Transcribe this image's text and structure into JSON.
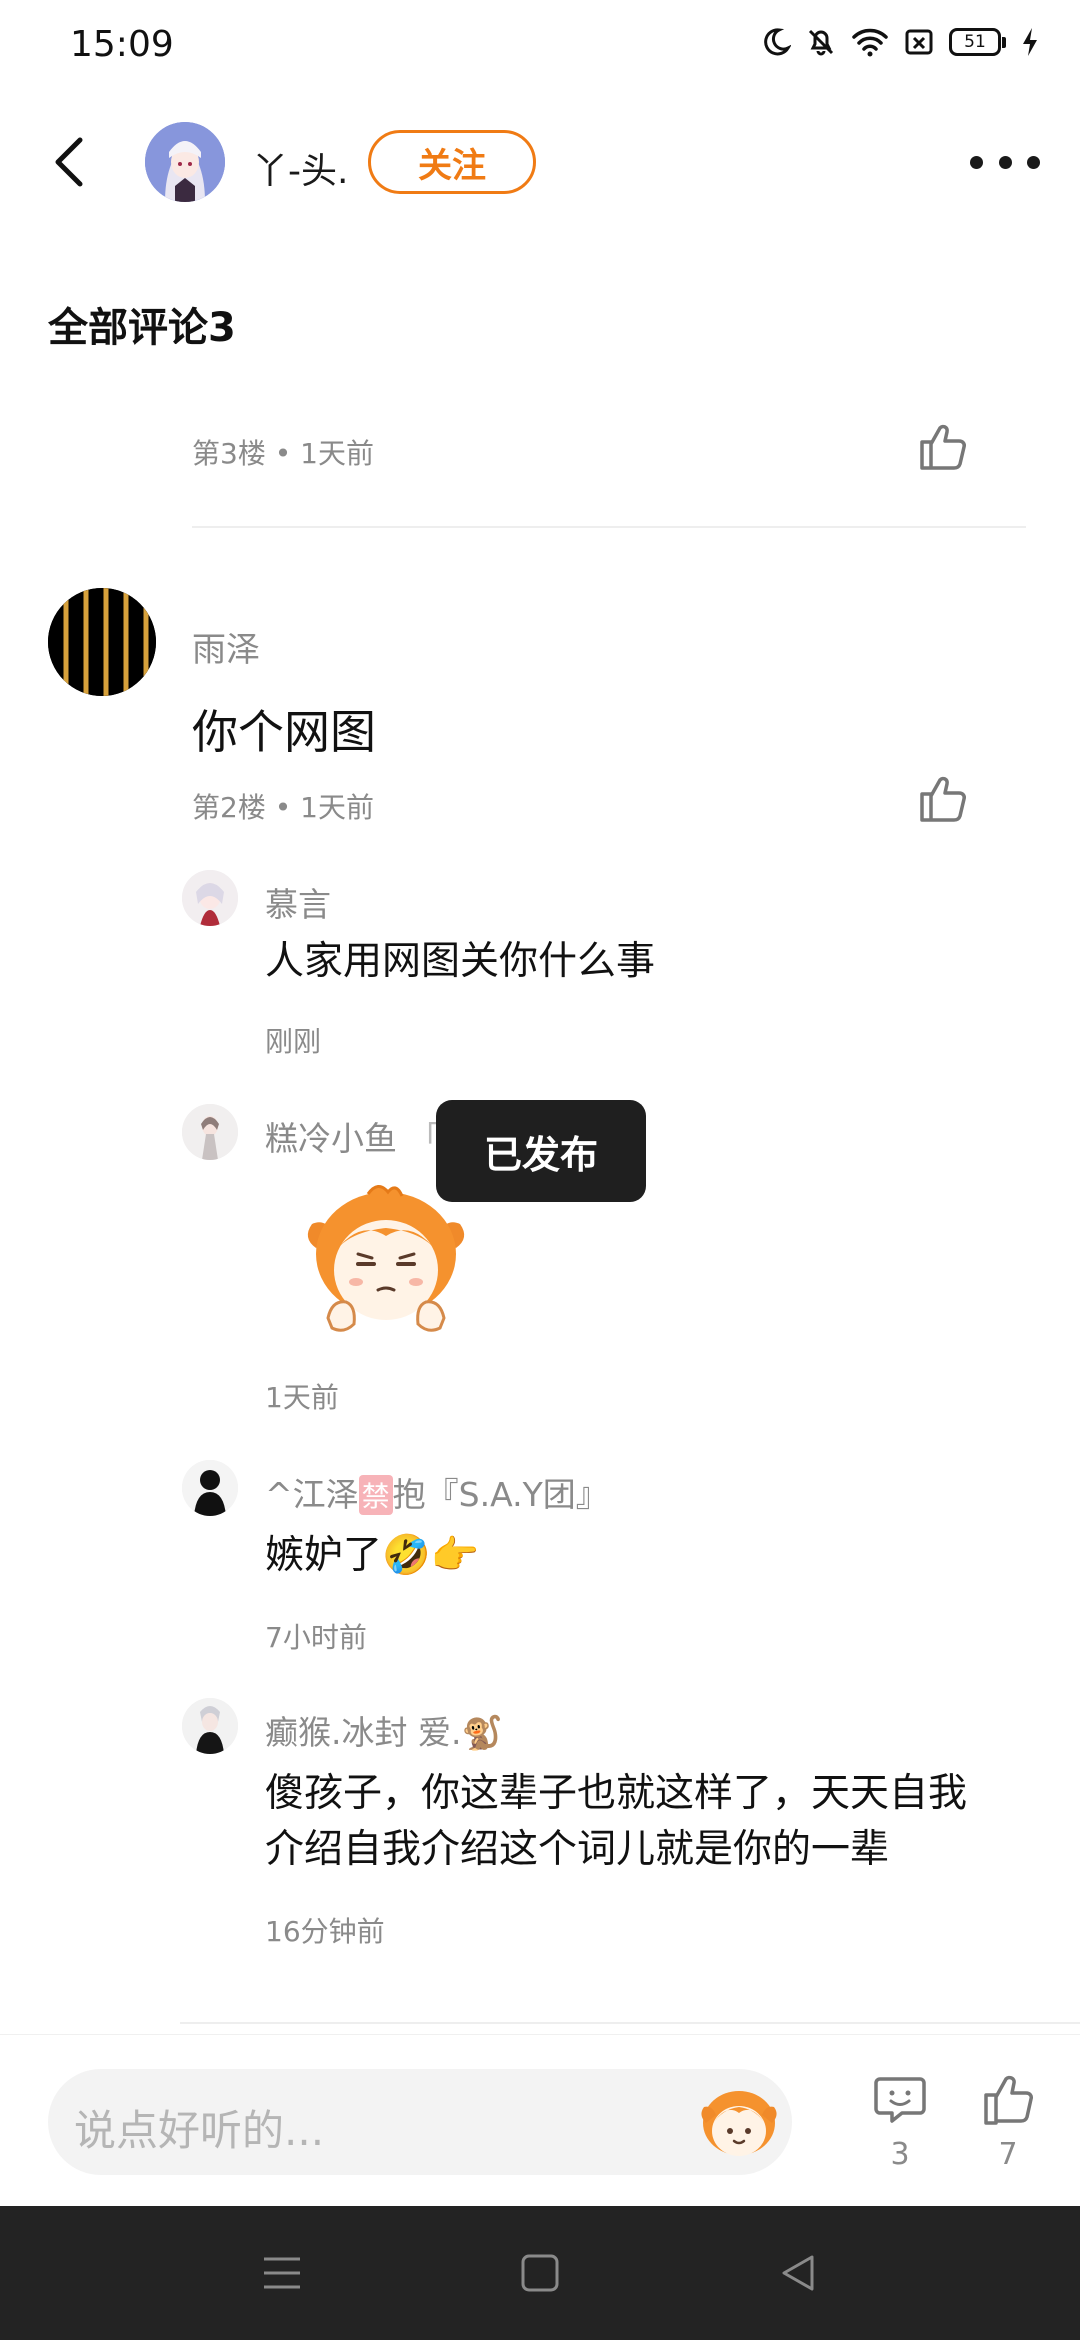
{
  "status_bar": {
    "time": "15:09",
    "battery": "51"
  },
  "header": {
    "username": "丫-头.",
    "follow_label": "关注"
  },
  "comments_title": "全部评论3",
  "floor3": {
    "meta": "第3楼 • 1天前"
  },
  "floor2": {
    "username": "雨泽",
    "content": "你个网图",
    "meta": "第2楼 • 1天前",
    "replies": [
      {
        "username": "慕言",
        "content": "人家用网图关你什么事",
        "time": "刚刚"
      },
      {
        "username": "糕冷小鱼",
        "name_suffix": "「",
        "time": "1天前"
      },
      {
        "username_prefix": "^江泽",
        "username_tag": "禁",
        "username_suffix": "抱『S.A.Y团』",
        "content": "嫉妒了🤣👉",
        "time": "7小时前"
      },
      {
        "username": "癫猴.冰封 爱.🐒",
        "content_line1": "傻孩子，你这辈子也就这样了，天天自我",
        "content_line2": "介绍自我介绍这个词儿就是你的一辈",
        "time": "16分钟前"
      }
    ]
  },
  "toast": "已发布",
  "input": {
    "placeholder": "说点好听的..."
  },
  "actions": {
    "comments_count": "3",
    "likes_count": "7"
  },
  "colors": {
    "accent": "#f07b14",
    "nav_bg": "#232323",
    "toast_bg": "#1f1f1f"
  }
}
